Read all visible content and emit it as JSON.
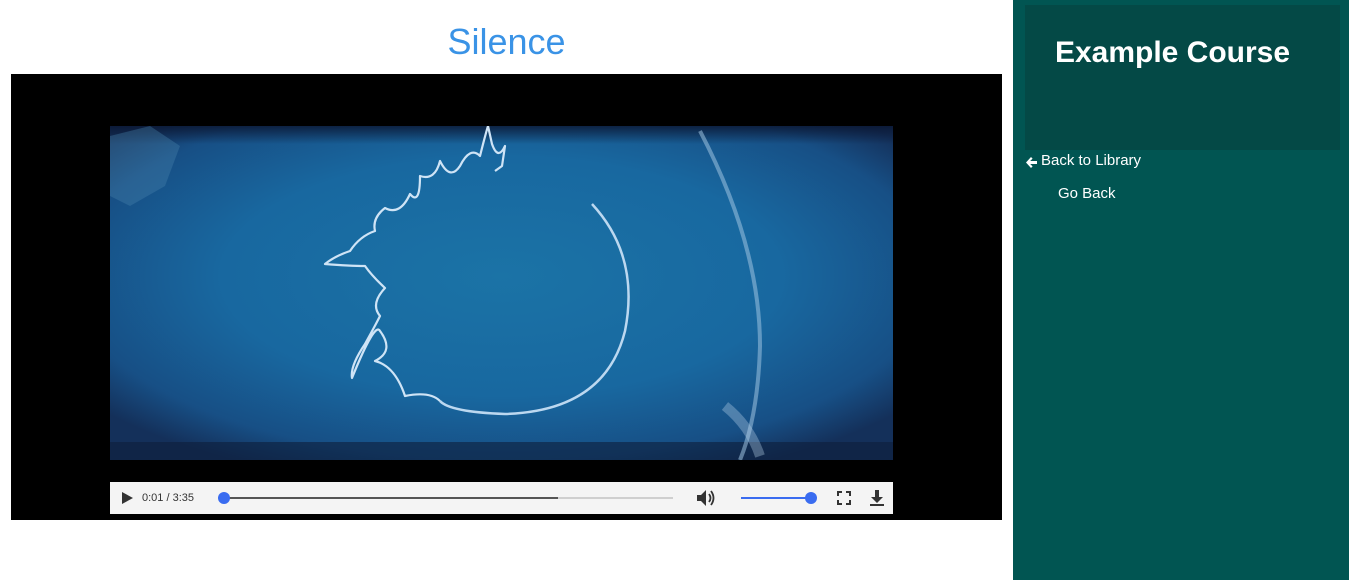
{
  "page": {
    "title": "Silence"
  },
  "video": {
    "current_time": "0:01",
    "duration": "3:35",
    "time_display": "0:01 / 3:35",
    "progress_fraction": 0.005,
    "buffered_fraction": 0.745,
    "volume_fraction": 1.0,
    "icons": {
      "play": "play-icon",
      "volume": "volume-icon",
      "fullscreen": "fullscreen-icon",
      "download": "download-icon"
    },
    "colors": {
      "accent": "#3a6cf0",
      "frame_background": "#000000",
      "controls_background": "#f4f4f4"
    }
  },
  "sidebar": {
    "course_title": "Example Course",
    "back_link_label": "Back to Library",
    "back_link_icon": "arrow-left-icon",
    "go_back_label": "Go Back",
    "colors": {
      "background": "#015552",
      "header_background": "#044946",
      "text": "#ffffff"
    }
  },
  "colors": {
    "title": "#3a93e6"
  }
}
